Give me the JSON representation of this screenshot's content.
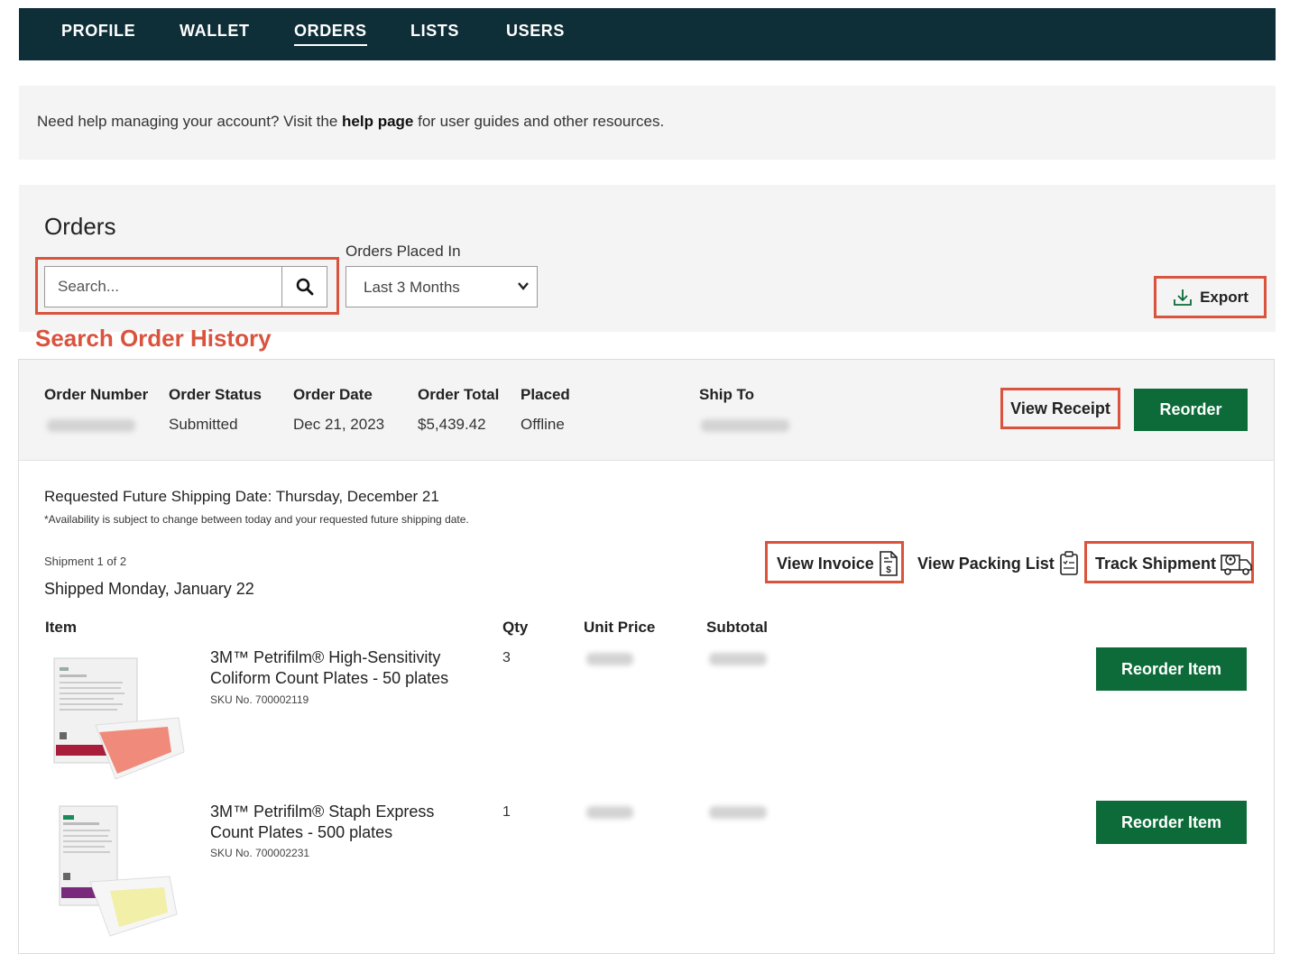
{
  "nav": {
    "tabs": [
      {
        "label": "PROFILE"
      },
      {
        "label": "WALLET"
      },
      {
        "label": "ORDERS"
      },
      {
        "label": "LISTS"
      },
      {
        "label": "USERS"
      }
    ],
    "active": "ORDERS"
  },
  "help": {
    "prefix": "Need help managing your account? Visit the ",
    "link": "help page",
    "suffix": " for user guides and other resources."
  },
  "orders": {
    "title": "Orders",
    "search_placeholder": "Search...",
    "placed_in_label": "Orders Placed In",
    "placed_in_value": "Last 3 Months",
    "export_label": "Export",
    "search_caption": "Search Order History"
  },
  "order": {
    "headers": {
      "number": "Order Number",
      "status": "Order Status",
      "date": "Order Date",
      "total": "Order Total",
      "placed": "Placed",
      "ship_to": "Ship To"
    },
    "status": "Submitted",
    "date": "Dec 21, 2023",
    "total": "$5,439.42",
    "placed": "Offline",
    "view_receipt_label": "View Receipt",
    "reorder_label": "Reorder"
  },
  "shipment": {
    "requested": "Requested Future Shipping Date: Thursday, December 21",
    "note": "*Availability is subject to change between today and your requested future shipping date.",
    "count": "Shipment 1 of 2",
    "shipped": "Shipped Monday, January 22",
    "view_invoice_label": "View Invoice",
    "view_packing_label": "View Packing List",
    "track_label": "Track Shipment"
  },
  "items_table": {
    "headers": {
      "item": "Item",
      "qty": "Qty",
      "unit_price": "Unit Price",
      "subtotal": "Subtotal"
    },
    "reorder_item_label": "Reorder Item",
    "items": [
      {
        "name": "3M™ Petrifilm® High-Sensitivity Coliform Count Plates - 50 plates",
        "sku": "SKU No. 700002119",
        "qty": "3"
      },
      {
        "name": "3M™ Petrifilm® Staph Express Count Plates - 500 plates",
        "sku": "SKU No. 700002231",
        "qty": "1"
      }
    ]
  },
  "colors": {
    "nav_bg": "#0f2f38",
    "accent_green": "#0c6b38",
    "highlight_red": "#d9533d",
    "panel_bg": "#f4f4f4"
  }
}
